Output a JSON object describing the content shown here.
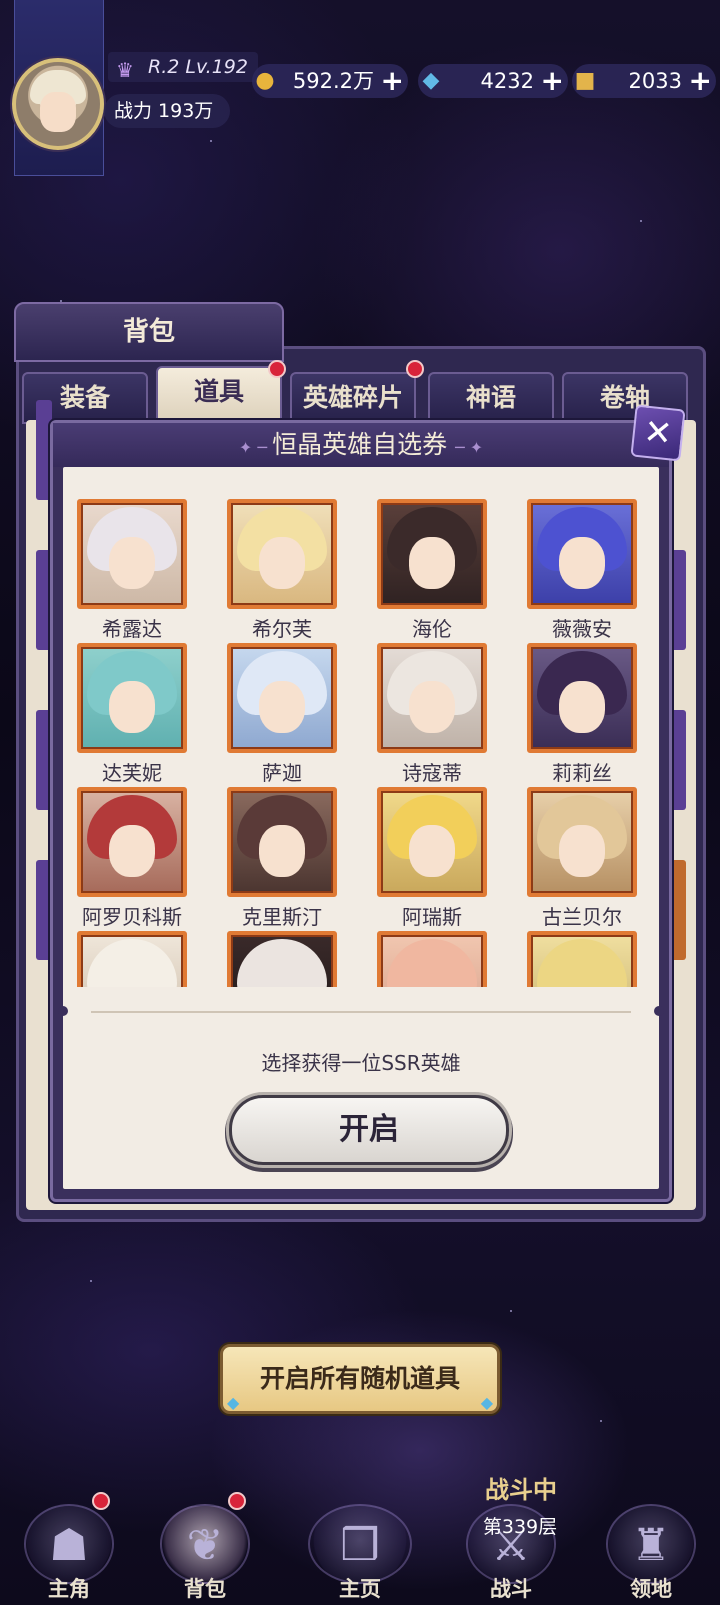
{
  "player": {
    "rank": "R.2 Lv.192",
    "power": "战力 193万"
  },
  "resources": [
    {
      "icon": "gold-coin-icon",
      "value": "592.2万"
    },
    {
      "icon": "blue-crystal-icon",
      "value": "4232"
    },
    {
      "icon": "gold-ticket-icon",
      "value": "2033"
    }
  ],
  "bag": {
    "title": "背包",
    "tabs": [
      "装备",
      "道具",
      "英雄碎片",
      "神语",
      "卷轴"
    ],
    "active_tab": "道具"
  },
  "popup": {
    "title": "恒晶英雄自选券",
    "heroes": [
      "希露达",
      "希尔芙",
      "海伦",
      "薇薇安",
      "达芙妮",
      "萨迦",
      "诗寇蒂",
      "莉莉丝",
      "阿罗贝科斯",
      "克里斯汀",
      "阿瑞斯",
      "古兰贝尔",
      "",
      "",
      "",
      ""
    ],
    "hint": "选择获得一位SSR英雄",
    "open_button": "开启"
  },
  "open_all_button": "开启所有随机道具",
  "nav": {
    "items": [
      "主角",
      "背包",
      "主页",
      "战斗",
      "领地"
    ],
    "battle_status": "战斗中",
    "battle_floor": "第339层"
  },
  "colors": {
    "portrait_border": "#e07a34",
    "accent_purple": "#3a2f5c",
    "badge_red": "#d8243a"
  }
}
